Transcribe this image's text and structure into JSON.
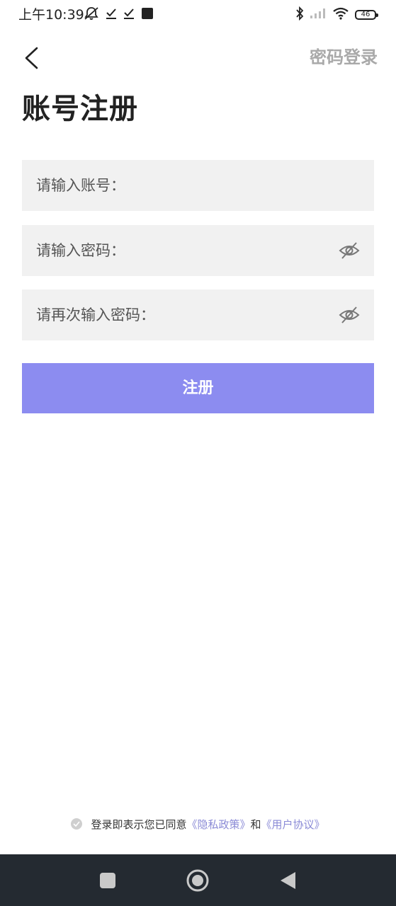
{
  "status_bar": {
    "time": "上午10:39",
    "battery": "46",
    "icons": [
      "mute-icon",
      "check-icon",
      "check-icon",
      "square-icon",
      "bluetooth-icon",
      "signal-icon",
      "wifi-icon",
      "battery-icon"
    ]
  },
  "header": {
    "back_icon": "chevron-left-icon",
    "password_login": "密码登录",
    "title": "账号注册"
  },
  "form": {
    "account_label": "请输入账号：",
    "password_label": "请输入密码：",
    "confirm_label": "请再次输入密码：",
    "account_value": "",
    "password_value": "",
    "confirm_value": "",
    "eye_icon": "eye-off-icon",
    "register_label": "注册"
  },
  "agreement": {
    "prefix": "登录即表示您已同意",
    "privacy": "《隐私政策》",
    "and": "和",
    "terms": "《用户协议》"
  },
  "nav": {
    "icons": [
      "square-icon",
      "home-circle-icon",
      "back-triangle-icon"
    ]
  },
  "colors": {
    "accent": "#8c8cf0",
    "link": "#8a8ad6",
    "field_bg": "#f1f1f1",
    "muted": "#a9a9a9",
    "navbar": "#242a31"
  }
}
